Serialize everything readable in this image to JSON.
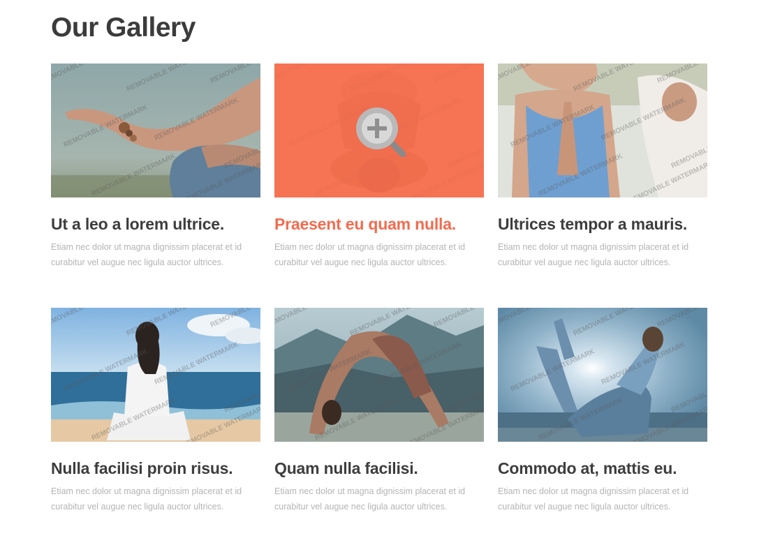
{
  "page": {
    "title": "Our Gallery"
  },
  "gallery": {
    "items": [
      {
        "title": "Ut a leo a lorem ultrice.",
        "text": "Etiam nec dolor ut magna dignissim placerat et id curabitur vel augue nec ligula auctor ultrices.",
        "active": false
      },
      {
        "title": "Praesent eu quam nulla.",
        "text": "Etiam nec dolor ut magna dignissim placerat et id curabitur vel augue nec ligula auctor ultrices.",
        "active": true
      },
      {
        "title": "Ultrices tempor a mauris.",
        "text": "Etiam nec dolor ut magna dignissim placerat et id curabitur vel augue nec ligula auctor ultrices.",
        "active": false
      },
      {
        "title": "Nulla facilisi proin risus.",
        "text": "Etiam nec dolor ut magna dignissim placerat et id curabitur vel augue nec ligula auctor ultrices.",
        "active": false
      },
      {
        "title": "Quam nulla facilisi.",
        "text": "Etiam nec dolor ut magna dignissim placerat et id curabitur vel augue nec ligula auctor ultrices.",
        "active": false
      },
      {
        "title": "Commodo at, mattis eu.",
        "text": "Etiam nec dolor ut magna dignissim placerat et id curabitur vel augue nec ligula auctor ultrices.",
        "active": false
      }
    ]
  },
  "watermark": {
    "text": "REMOVABLE WATERMARK"
  },
  "colors": {
    "accent": "#f26b4f",
    "heading": "#3b3b3b",
    "body_text": "#b4b4b4"
  },
  "icons": {
    "zoom": "magnifier-plus-icon"
  }
}
